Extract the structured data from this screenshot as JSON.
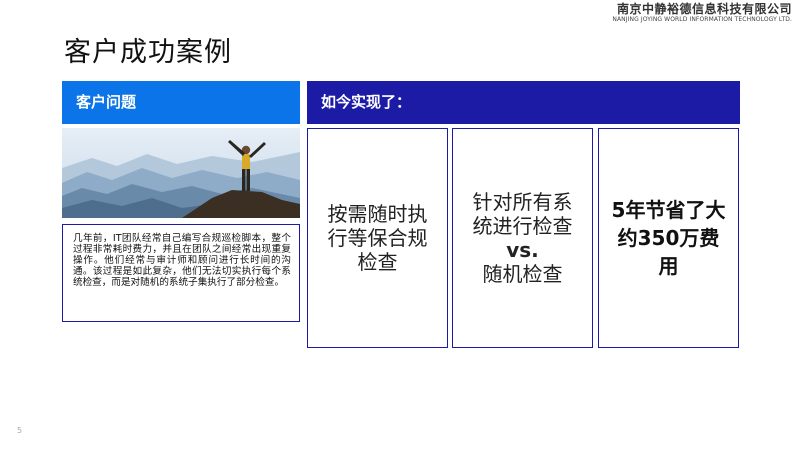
{
  "company": {
    "name_cn": "南京中静裕德信息科技有限公司",
    "name_en": "NANJING JOYING WORLD INFORMATION TECHNOLOGY LTD."
  },
  "title": "客户成功案例",
  "left_header": "客户问题",
  "right_header": "如今实现了：",
  "story": "几年前，IT团队经常自己编写合规巡检脚本，整个过程非常耗时费力，并且在团队之间经常出现重复操作。他们经常与审计师和顾问进行长时间的沟通。该过程是如此复杂，他们无法切实执行每个系统检查，而是对随机的系统子集执行了部分检查。",
  "cards": {
    "card1": "按需随时执行等保合规检查",
    "card2_top": "针对所有系统进行检查",
    "card2_vs": "vs.",
    "card2_bottom": "随机检查",
    "card3": "5年节省了大约350万费用"
  },
  "page_number": "5"
}
